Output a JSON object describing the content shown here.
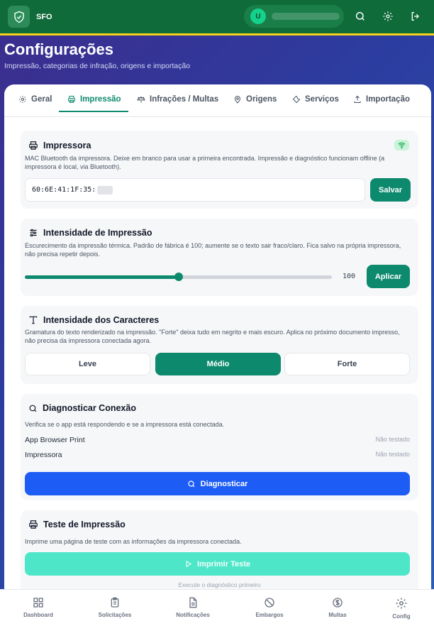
{
  "header": {
    "app_title": "SFO",
    "user_initial": "U"
  },
  "page": {
    "title": "Configurações",
    "subtitle": "Impressão, categorias de infração, origens e importação"
  },
  "tabs": [
    {
      "label": "Geral",
      "icon": "gear-icon"
    },
    {
      "label": "Impressão",
      "icon": "printer-icon"
    },
    {
      "label": "Infrações / Multas",
      "icon": "scale-icon"
    },
    {
      "label": "Origens",
      "icon": "map-pin-icon"
    },
    {
      "label": "Serviços",
      "icon": "wrench-icon"
    },
    {
      "label": "Importação",
      "icon": "upload-icon"
    }
  ],
  "printer": {
    "title": "Impressora",
    "description": "MAC Bluetooth da impressora. Deixe em branco para usar a primeira encontrada. Impressão e diagnóstico funcionam offline (a impressora é local, via Bluetooth).",
    "mac_value": "60:6E:41:1F:35:",
    "save_label": "Salvar"
  },
  "intensity": {
    "title": "Intensidade de Impressão",
    "description": "Escurecimento da impressão térmica. Padrão de fábrica é 100; aumente se o texto sair fraco/claro. Fica salvo na própria impressora, não precisa repetir depois.",
    "value": "100",
    "slider_fraction": 0.5,
    "apply_label": "Aplicar"
  },
  "characters": {
    "title": "Intensidade dos Caracteres",
    "description": "Gramatura do texto renderizado na impressão. \"Forte\" deixa tudo em negrito e mais escuro. Aplica no próximo documento impresso, não precisa da impressora conectada agora.",
    "options": [
      "Leve",
      "Médio",
      "Forte"
    ],
    "selected": "Médio"
  },
  "diagnostic": {
    "title": "Diagnosticar Conexão",
    "description": "Verifica se o app está respondendo e se a impressora está conectada.",
    "rows": [
      {
        "label": "App Browser Print",
        "status": "Não testado"
      },
      {
        "label": "Impressora",
        "status": "Não testado"
      }
    ],
    "button_label": "Diagnosticar"
  },
  "test_print": {
    "title": "Teste de Impressão",
    "description": "Imprime uma página de teste com as informações da impressora conectada.",
    "button_label": "Imprimir Teste",
    "hint": "Execute o diagnóstico primeiro"
  },
  "bottom_nav": [
    {
      "label": "Dashboard",
      "icon": "grid-icon"
    },
    {
      "label": "Solicitações",
      "icon": "clipboard-icon"
    },
    {
      "label": "Notificações",
      "icon": "document-icon"
    },
    {
      "label": "Embargos",
      "icon": "ban-icon"
    },
    {
      "label": "Multas",
      "icon": "dollar-icon"
    },
    {
      "label": "Config",
      "icon": "gear-icon"
    }
  ],
  "colors": {
    "primary_green": "#0f6b3a",
    "accent_yellow": "#f6d21b",
    "teal": "#0d8a6e",
    "blue": "#1d5cf5"
  }
}
